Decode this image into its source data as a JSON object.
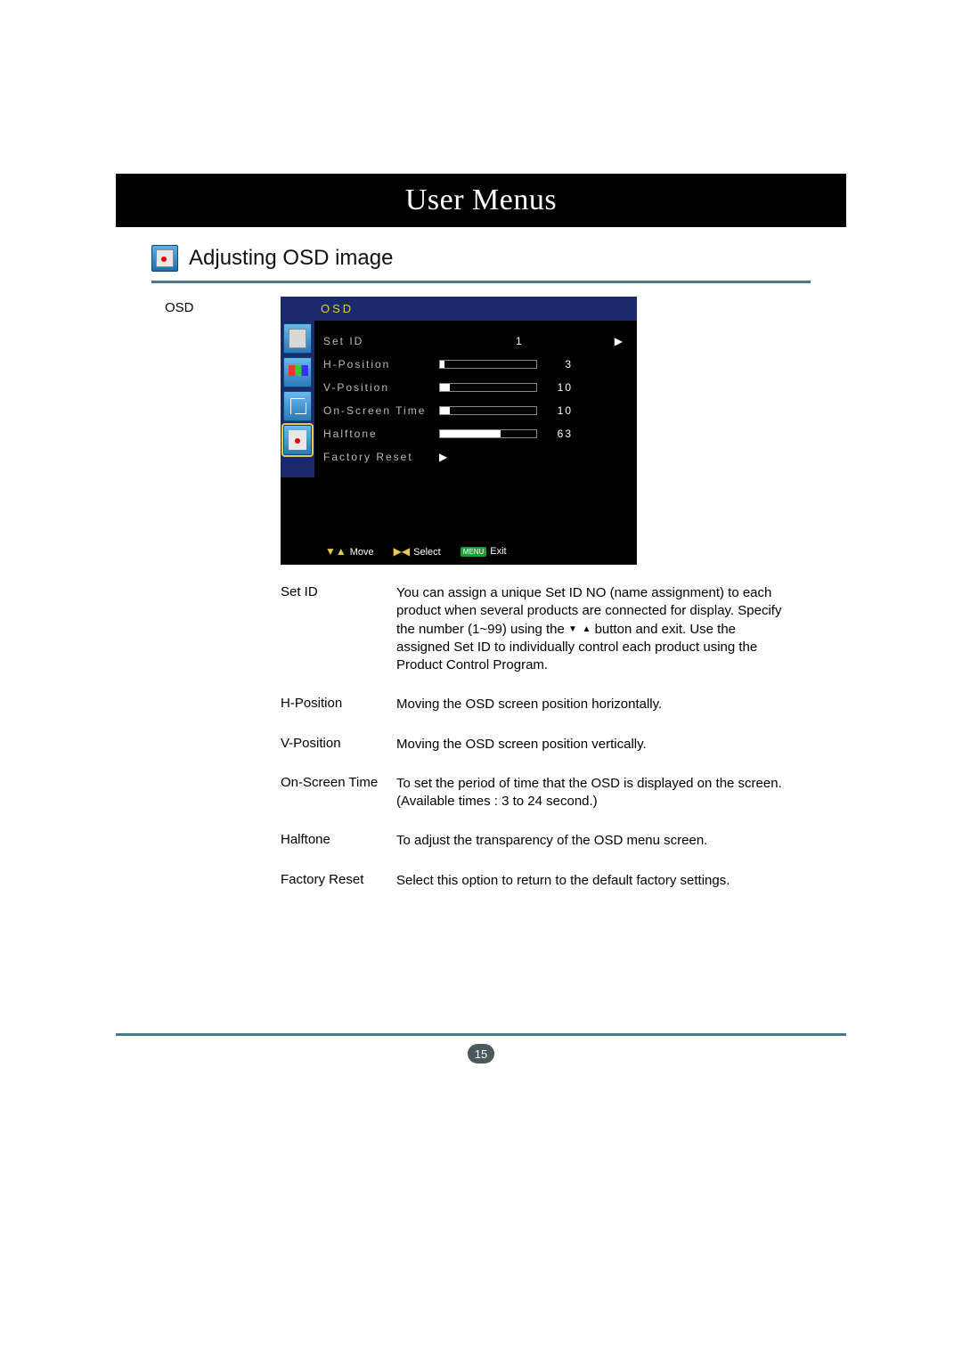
{
  "header": {
    "title": "User Menus"
  },
  "section": {
    "title": "Adjusting OSD image"
  },
  "left_label": "OSD",
  "osd": {
    "title": "OSD",
    "rows": {
      "set_id": {
        "label": "Set ID",
        "value": "1"
      },
      "h_position": {
        "label": "H-Position",
        "value": "3",
        "fill_pct": 5
      },
      "v_position": {
        "label": "V-Position",
        "value": "10",
        "fill_pct": 10
      },
      "on_screen_time": {
        "label": "On-Screen Time",
        "value": "10",
        "fill_pct": 10
      },
      "halftone": {
        "label": "Halftone",
        "value": "63",
        "fill_pct": 63
      },
      "factory_reset": {
        "label": "Factory Reset"
      }
    },
    "footer": {
      "move": "Move",
      "select": "Select",
      "exit": "Exit",
      "menu_label": "MENU"
    }
  },
  "descriptions": [
    {
      "label": "Set ID",
      "text_a": "You can assign a unique Set ID NO (name assignment) to each product when several products are connected for display. Specify the number (1~99) using the ",
      "text_b": " button and exit. Use the assigned Set ID to individually control each product using the Product Control Program."
    },
    {
      "label": "H-Position",
      "text": "Moving the OSD screen position horizontally."
    },
    {
      "label": "V-Position",
      "text": "Moving the OSD screen position vertically."
    },
    {
      "label": "On-Screen Time",
      "text": "To set the period of time that the OSD is displayed on the screen. (Available times : 3 to 24 second.)"
    },
    {
      "label": "Halftone",
      "text": "To adjust the transparency of the OSD menu screen."
    },
    {
      "label": "Factory Reset",
      "text": "Select this option to return to the default factory settings."
    }
  ],
  "page_number": "15"
}
